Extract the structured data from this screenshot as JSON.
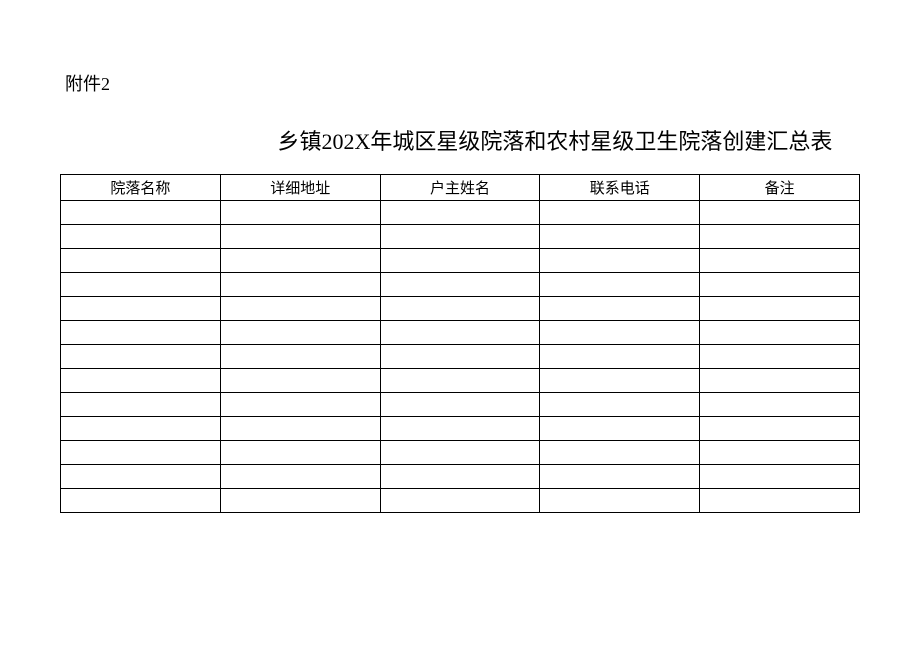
{
  "attachment_label": "附件2",
  "title": "乡镇202X年城区星级院落和农村星级卫生院落创建汇总表",
  "table": {
    "headers": [
      "院落名称",
      "详细地址",
      "户主姓名",
      "联系电话",
      "备注"
    ],
    "rows": [
      [
        "",
        "",
        "",
        "",
        ""
      ],
      [
        "",
        "",
        "",
        "",
        ""
      ],
      [
        "",
        "",
        "",
        "",
        ""
      ],
      [
        "",
        "",
        "",
        "",
        ""
      ],
      [
        "",
        "",
        "",
        "",
        ""
      ],
      [
        "",
        "",
        "",
        "",
        ""
      ],
      [
        "",
        "",
        "",
        "",
        ""
      ],
      [
        "",
        "",
        "",
        "",
        ""
      ],
      [
        "",
        "",
        "",
        "",
        ""
      ],
      [
        "",
        "",
        "",
        "",
        ""
      ],
      [
        "",
        "",
        "",
        "",
        ""
      ],
      [
        "",
        "",
        "",
        "",
        ""
      ],
      [
        "",
        "",
        "",
        "",
        ""
      ]
    ]
  }
}
